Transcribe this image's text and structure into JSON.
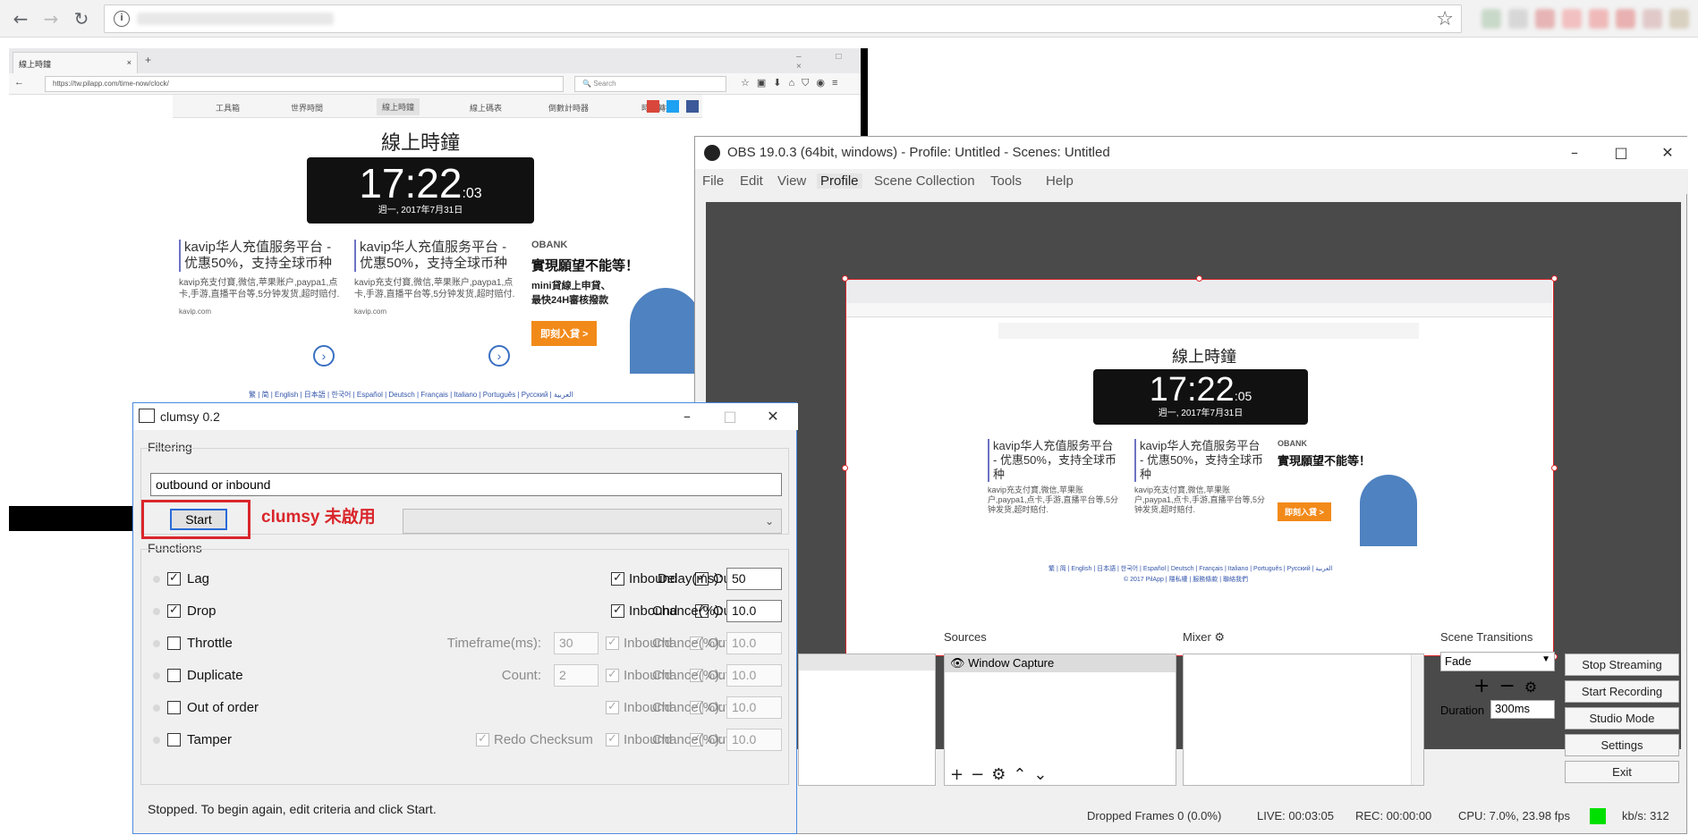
{
  "chrome": {
    "back_icon": "←",
    "forward_icon": "→",
    "reload_icon": "↻",
    "info_icon": "i",
    "bookmark_icon": "☆",
    "extension_colors": [
      "#c9d9c9",
      "#d7d7d7",
      "#e6b4b4",
      "#f2c0c0",
      "#efb9b9",
      "#e9b1b1",
      "#e1c9c9",
      "#d8d0c0"
    ]
  },
  "firefox": {
    "tab_title": "線上時鐘",
    "new_tab": "+",
    "url": "https://tw.pilapp.com/time-now/clock/",
    "search_placeholder": "Search",
    "menu": [
      "工具箱",
      "世界時間",
      "線上時鐘",
      "線上碼表",
      "倒數計時器",
      "時區轉換"
    ],
    "page_title": "線上時鐘",
    "clock_time": "17:22",
    "clock_seconds": ":03",
    "clock_date": "週一, 2017年7月31日",
    "ads": [
      {
        "title": "kavip华人充值服务平台 - 优惠50%，支持全球币种",
        "body": "kavip充支付寶,微信,苹果账户,paypa1,点卡,手游,直播平台等,5分钟发货,超时赔付.",
        "link": "kavip.com"
      },
      {
        "title": "kavip华人充值服务平台 - 优惠50%，支持全球币种",
        "body": "kavip充支付寶,微信,苹果账户,paypa1,点卡,手游,直播平台等,5分钟发货,超时赔付.",
        "link": "kavip.com"
      }
    ],
    "bank_ad": {
      "brand": "OBANK",
      "headline": "實現願望不能等！",
      "line1": "mini貸線上申貸、",
      "line2": "最快24H審核撥款",
      "cta": "即刻入貸 >"
    },
    "languages": "繁 | 简 | English | 日本語 | 한국어 | Español | Deutsch | Français | Italiano | Português | Русский | العربية"
  },
  "obs": {
    "title": "OBS 19.0.3 (64bit, windows) - Profile: Untitled - Scenes: Untitled",
    "menu": [
      "File",
      "Edit",
      "View",
      "Profile",
      "Scene Collection",
      "Tools",
      "Help"
    ],
    "preview": {
      "clock_time": "17:22",
      "clock_seconds": ":05",
      "clock_date": "週一, 2017年7月31日",
      "footer": "© 2017 PilApp | 隱私權 | 服務條款 | 聯絡我們"
    },
    "sources_label": "Sources",
    "source_item": "Window Capture",
    "mixer_label": "Mixer",
    "transitions_label": "Scene Transitions",
    "transition_value": "Fade",
    "duration_label": "Duration",
    "duration_value": "300ms",
    "buttons": [
      "Stop Streaming",
      "Start Recording",
      "Studio Mode",
      "Settings",
      "Exit"
    ],
    "status": {
      "dropped": "Dropped Frames 0 (0.0%)",
      "live": "LIVE: 00:03:05",
      "rec": "REC: 00:00:00",
      "cpu": "CPU: 7.0%, 23.98 fps",
      "kbs": "kb/s: 312",
      "indicator_color": "#00e000"
    }
  },
  "clumsy": {
    "title": "clumsy 0.2",
    "filtering_label": "Filtering",
    "filter_value": "outbound or inbound",
    "start_label": "Start",
    "annotation": "clumsy 未啟用",
    "annotation_color": "#d9262b",
    "functions_label": "Functions",
    "functions": [
      {
        "name": "Lag",
        "checked": true,
        "extra": "",
        "extra_value": "",
        "inbound": true,
        "outbound": true,
        "param_label": "Delay(ms):",
        "param_value": "50",
        "enabled": true
      },
      {
        "name": "Drop",
        "checked": true,
        "extra": "",
        "extra_value": "",
        "inbound": true,
        "outbound": true,
        "param_label": "Chance(%):",
        "param_value": "10.0",
        "enabled": true
      },
      {
        "name": "Throttle",
        "checked": false,
        "extra": "Timeframe(ms):",
        "extra_value": "30",
        "inbound": true,
        "outbound": true,
        "param_label": "Chance(%):",
        "param_value": "10.0",
        "enabled": false
      },
      {
        "name": "Duplicate",
        "checked": false,
        "extra": "Count:",
        "extra_value": "2",
        "inbound": true,
        "outbound": true,
        "param_label": "Chance(%):",
        "param_value": "10.0",
        "enabled": false
      },
      {
        "name": "Out of order",
        "checked": false,
        "extra": "",
        "extra_value": "",
        "inbound": true,
        "outbound": true,
        "param_label": "Chance(%):",
        "param_value": "10.0",
        "enabled": false
      },
      {
        "name": "Tamper",
        "checked": false,
        "extra": "Redo Checksum",
        "extra_value": "",
        "inbound": true,
        "outbound": true,
        "param_label": "Chance(%):",
        "param_value": "10.0",
        "enabled": false
      }
    ],
    "inbound_label": "Inbound",
    "outbound_label": "Outbound",
    "status_text": "Stopped. To begin again, edit criteria and click Start."
  }
}
